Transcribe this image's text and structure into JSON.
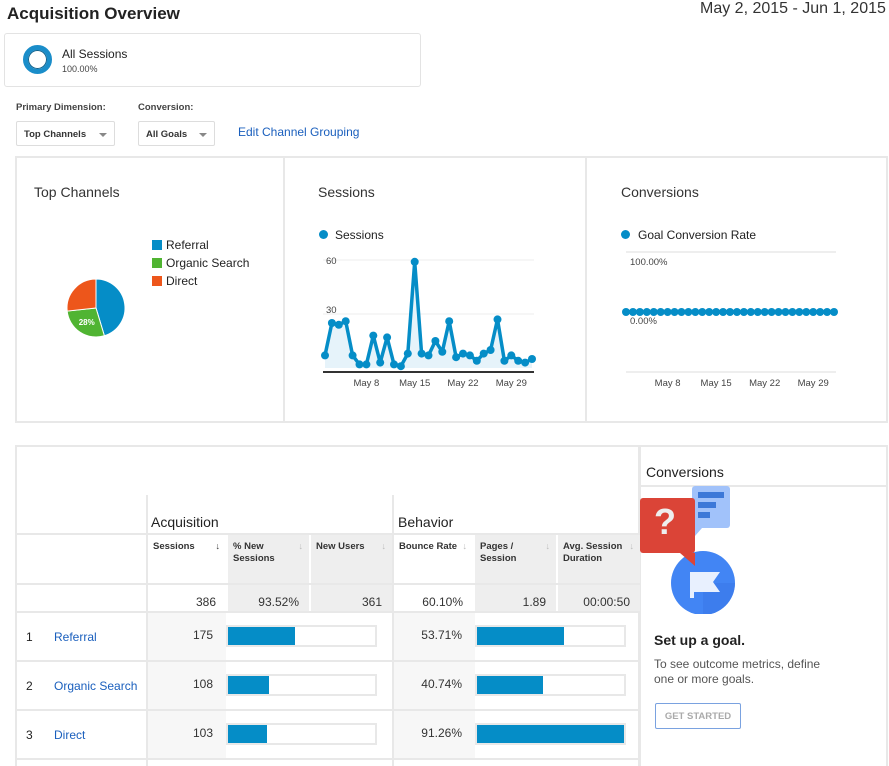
{
  "header": {
    "title": "Acquisition Overview",
    "date_range": "May 2, 2015 - Jun 1, 2015"
  },
  "segment": {
    "name": "All Sessions",
    "percent": "100.00%"
  },
  "controls": {
    "primary_dimension_label": "Primary Dimension:",
    "primary_dimension_value": "Top Channels",
    "conversion_label": "Conversion:",
    "conversion_value": "All Goals",
    "edit_link": "Edit Channel Grouping"
  },
  "colors": {
    "referral": "#058dc7",
    "organic_search": "#50b432",
    "direct": "#ed561b",
    "accent": "#058dc7",
    "link": "#1a5fbd"
  },
  "chart_data": [
    {
      "type": "pie",
      "title": "Top Channels",
      "categories": [
        "Referral",
        "Organic Search",
        "Direct"
      ],
      "values": [
        175,
        108,
        103
      ],
      "slice_labels": [
        "",
        "28%",
        ""
      ],
      "legend": "right"
    },
    {
      "type": "area",
      "title": "Sessions",
      "legend": [
        "Sessions"
      ],
      "x": [
        "May 2",
        "May 3",
        "May 4",
        "May 5",
        "May 6",
        "May 7",
        "May 8",
        "May 9",
        "May 10",
        "May 11",
        "May 12",
        "May 13",
        "May 14",
        "May 15",
        "May 16",
        "May 17",
        "May 18",
        "May 19",
        "May 20",
        "May 21",
        "May 22",
        "May 23",
        "May 24",
        "May 25",
        "May 26",
        "May 27",
        "May 28",
        "May 29",
        "May 30",
        "May 31",
        "Jun 1"
      ],
      "series": [
        {
          "name": "Sessions",
          "values": [
            7,
            25,
            24,
            26,
            7,
            2,
            2,
            18,
            3,
            17,
            2,
            1,
            8,
            59,
            8,
            7,
            15,
            9,
            26,
            6,
            8,
            7,
            4,
            8,
            10,
            27,
            4,
            7,
            4,
            3,
            5
          ]
        }
      ],
      "xticks": [
        "May 8",
        "May 15",
        "May 22",
        "May 29"
      ],
      "yticks": [
        "30",
        "60"
      ],
      "ylim": [
        0,
        60
      ],
      "grid": true
    },
    {
      "type": "line",
      "title": "Conversions",
      "legend": [
        "Goal Conversion Rate"
      ],
      "x": [
        "May 2",
        "May 3",
        "May 4",
        "May 5",
        "May 6",
        "May 7",
        "May 8",
        "May 9",
        "May 10",
        "May 11",
        "May 12",
        "May 13",
        "May 14",
        "May 15",
        "May 16",
        "May 17",
        "May 18",
        "May 19",
        "May 20",
        "May 21",
        "May 22",
        "May 23",
        "May 24",
        "May 25",
        "May 26",
        "May 27",
        "May 28",
        "May 29",
        "May 30",
        "May 31",
        "Jun 1"
      ],
      "series": [
        {
          "name": "Goal Conversion Rate",
          "values": [
            0,
            0,
            0,
            0,
            0,
            0,
            0,
            0,
            0,
            0,
            0,
            0,
            0,
            0,
            0,
            0,
            0,
            0,
            0,
            0,
            0,
            0,
            0,
            0,
            0,
            0,
            0,
            0,
            0,
            0,
            0
          ]
        }
      ],
      "xticks": [
        "May 8",
        "May 15",
        "May 22",
        "May 29"
      ],
      "yticks": [
        "100.00%",
        "0.00%"
      ],
      "ylim": [
        0,
        100
      ],
      "grid": true
    }
  ],
  "panels": {
    "top_channels_title": "Top Channels",
    "sessions_title": "Sessions",
    "conversions_title": "Conversions"
  },
  "table": {
    "group_acquisition": "Acquisition",
    "group_behavior": "Behavior",
    "group_conversions": "Conversions",
    "columns": [
      {
        "label": "Sessions",
        "sorted": true
      },
      {
        "label": "% New Sessions",
        "sorted": false
      },
      {
        "label": "New Users",
        "sorted": false
      },
      {
        "label": "Bounce Rate",
        "sorted": false
      },
      {
        "label": "Pages / Session",
        "sorted": false
      },
      {
        "label": "Avg. Session Duration",
        "sorted": false
      }
    ],
    "sort_arrow": "↓",
    "totals": [
      "386",
      "93.52%",
      "361",
      "60.10%",
      "1.89",
      "00:00:50"
    ],
    "rows": [
      {
        "index": "1",
        "channel": "Referral",
        "sessions": "175",
        "sessions_share": 0.4534,
        "bounce_rate": "53.71%",
        "bounce_share": 0.5885
      },
      {
        "index": "2",
        "channel": "Organic Search",
        "sessions": "108",
        "sessions_share": 0.2798,
        "bounce_rate": "40.74%",
        "bounce_share": 0.4464
      },
      {
        "index": "3",
        "channel": "Direct",
        "sessions": "103",
        "sessions_share": 0.2668,
        "bounce_rate": "91.26%",
        "bounce_share": 1.0
      }
    ]
  },
  "goal_promo": {
    "heading": "Set up a goal.",
    "text_line1": "To see outcome metrics, define",
    "text_line2": "one or more goals.",
    "button": "GET STARTED"
  }
}
